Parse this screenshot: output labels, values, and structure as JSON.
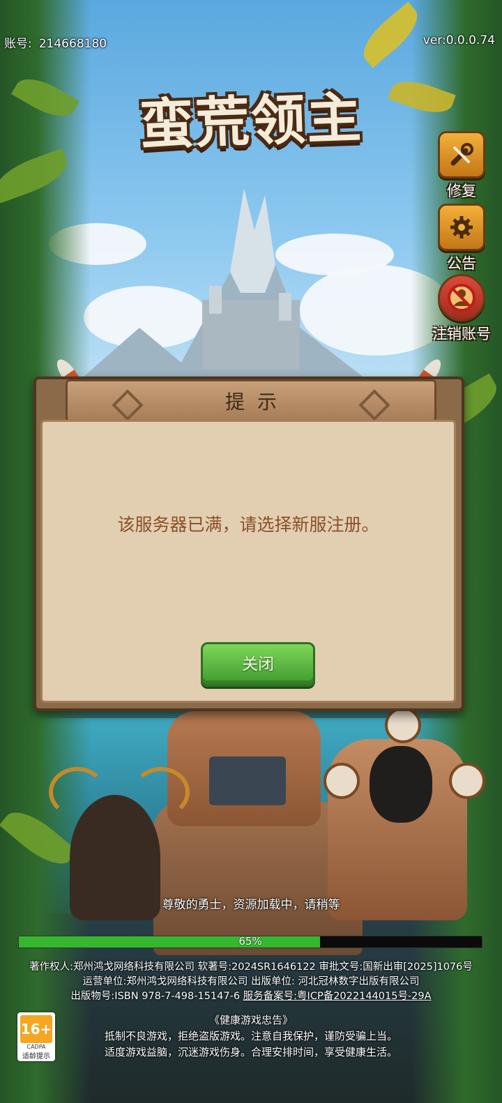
{
  "top_bar": {
    "account_label": "账号:",
    "account_id": "214668180",
    "version": "ver:0.0.0.74"
  },
  "game_title": "蛮荒领主",
  "side_menu": {
    "repair_label": "修复",
    "notice_label": "公告",
    "logout_label": "注销账号"
  },
  "dialog": {
    "title": "提示",
    "message": "该服务器已满，请选择新服注册。",
    "close_label": "关闭"
  },
  "loading": {
    "text": "尊敬的勇士，资源加载中，请稍等",
    "progress_percent": 65,
    "progress_label": "65%"
  },
  "legal": {
    "line1": "著作权人:郑州鸿戈网络科技有限公司 软著号:2024SR1646122 审批文号:国新出审[2025]1076号",
    "line2": "运营单位:郑州鸿戈网络科技有限公司 出版单位: 河北冠林数字出版有限公司",
    "line3a": "出版物号:ISBN 978-7-498-15147-6 ",
    "line3b": "服务备案号:粤ICP备2022144015号-29A"
  },
  "health_notice": {
    "title": "《健康游戏忠告》",
    "line1": "抵制不良游戏，拒绝盗版游戏。注意自我保护，谨防受骗上当。",
    "line2": "适度游戏益脑，沉迷游戏伤身。合理安排时间，享受健康生活。"
  },
  "age_rating": {
    "badge": "16+",
    "org": "CADPA",
    "tip": "适龄提示",
    "color": "#f5a623"
  }
}
